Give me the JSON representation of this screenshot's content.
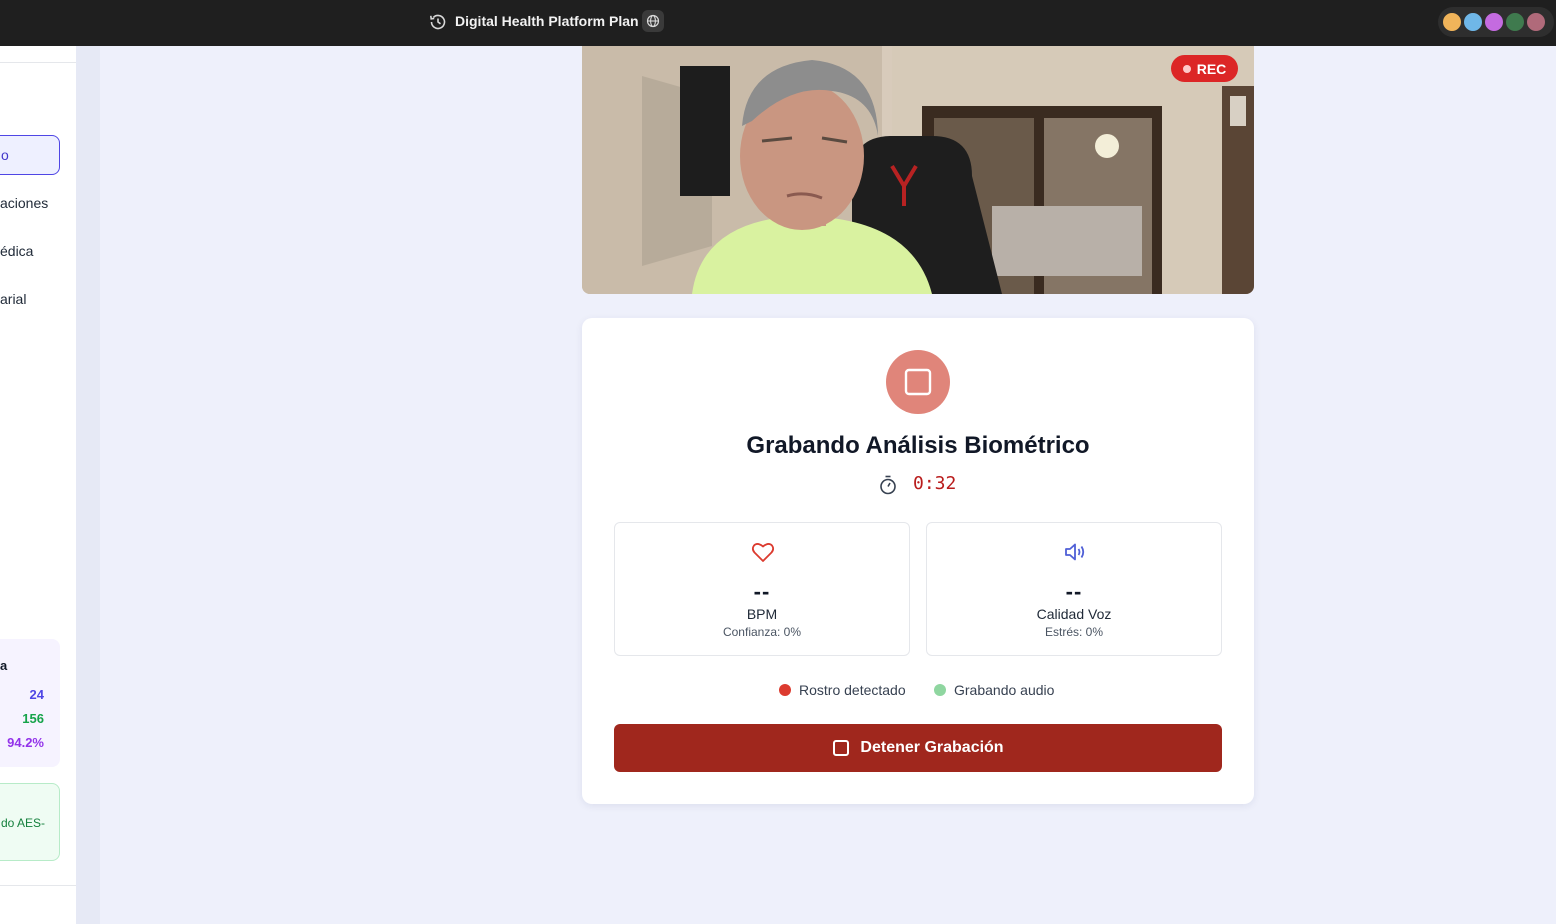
{
  "topbar": {
    "doc_title": "Digital Health Platform Plan",
    "icons": [
      "history-icon",
      "globe-icon"
    ],
    "collaborator_count": 5
  },
  "sidebar": {
    "active_item": "o",
    "items": [
      "aciones",
      "édica",
      "arial"
    ],
    "stats": {
      "title": "a",
      "values": [
        "24",
        "156",
        "94.2%"
      ]
    },
    "encryption_text": "do AES-"
  },
  "video": {
    "rec_label": "REC"
  },
  "recorder": {
    "title": "Grabando Análisis Biométrico",
    "timer": "0:32",
    "metrics": [
      {
        "icon": "heart-icon",
        "value": "--",
        "label": "BPM",
        "sub": "Confianza: 0%"
      },
      {
        "icon": "speaker-icon",
        "value": "--",
        "label": "Calidad Voz",
        "sub": "Estrés: 0%"
      }
    ],
    "indicators": [
      {
        "label": "Rostro detectado",
        "color": "#dc3b2f"
      },
      {
        "label": "Grabando audio",
        "color": "#8fd6a0"
      }
    ],
    "stop_button": "Detener Grabación"
  },
  "colors": {
    "accent": "#4f46e5",
    "danger": "#a0271d",
    "rec": "#dc2626",
    "background": "#eef0fb"
  }
}
